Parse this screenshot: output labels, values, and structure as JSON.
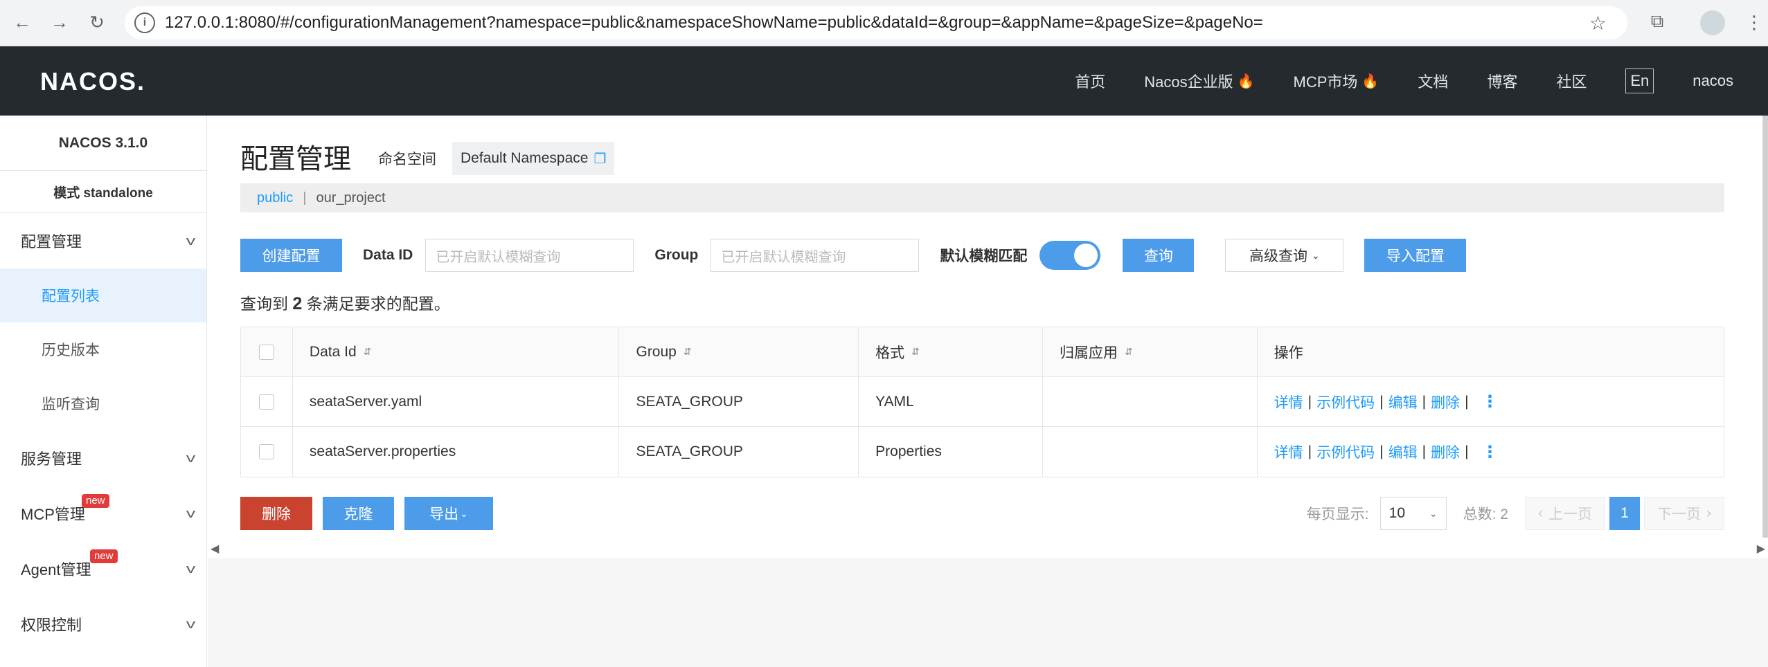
{
  "browser": {
    "url": "127.0.0.1:8080/#/configurationManagement?namespace=public&namespaceShowName=public&dataId=&group=&appName=&pageSize=&pageNo="
  },
  "header": {
    "logo": "NACOS.",
    "nav": [
      "首页",
      "Nacos企业版",
      "MCP市场",
      "文档",
      "博客",
      "社区"
    ],
    "lang": "En",
    "user": "nacos"
  },
  "sidebar": {
    "version": "NACOS 3.1.0",
    "mode": "模式 standalone",
    "groups": [
      {
        "label": "配置管理"
      },
      {
        "label": "服务管理"
      },
      {
        "label": "MCP管理",
        "badge": "new"
      },
      {
        "label": "Agent管理",
        "badge": "new"
      },
      {
        "label": "权限控制"
      }
    ],
    "items": [
      "配置列表",
      "历史版本",
      "监听查询"
    ]
  },
  "page": {
    "title": "配置管理",
    "namespace_label": "命名空间",
    "namespace_value": "Default Namespace",
    "ns_public": "public",
    "ns_sep": "|",
    "ns_project": "our_project"
  },
  "filters": {
    "create_btn": "创建配置",
    "dataid_label": "Data ID",
    "dataid_placeholder": "已开启默认模糊查询",
    "group_label": "Group",
    "group_placeholder": "已开启默认模糊查询",
    "fuzzy_label": "默认模糊匹配",
    "query_btn": "查询",
    "advanced_btn": "高级查询",
    "import_btn": "导入配置"
  },
  "result": {
    "prefix": "查询到",
    "count": "2",
    "suffix": "条满足要求的配置。"
  },
  "table": {
    "headers": [
      "Data Id",
      "Group",
      "格式",
      "归属应用",
      "操作"
    ],
    "rows": [
      {
        "dataId": "seataServer.yaml",
        "group": "SEATA_GROUP",
        "format": "YAML",
        "app": ""
      },
      {
        "dataId": "seataServer.properties",
        "group": "SEATA_GROUP",
        "format": "Properties",
        "app": ""
      }
    ],
    "ops": [
      "详情",
      "示例代码",
      "编辑",
      "删除"
    ]
  },
  "bottom": {
    "delete_btn": "删除",
    "clone_btn": "克隆",
    "export_btn": "导出"
  },
  "pager": {
    "per_page_label": "每页显示:",
    "per_page": "10",
    "total_label": "总数: 2",
    "prev": "上一页",
    "current": "1",
    "next": "下一页"
  }
}
